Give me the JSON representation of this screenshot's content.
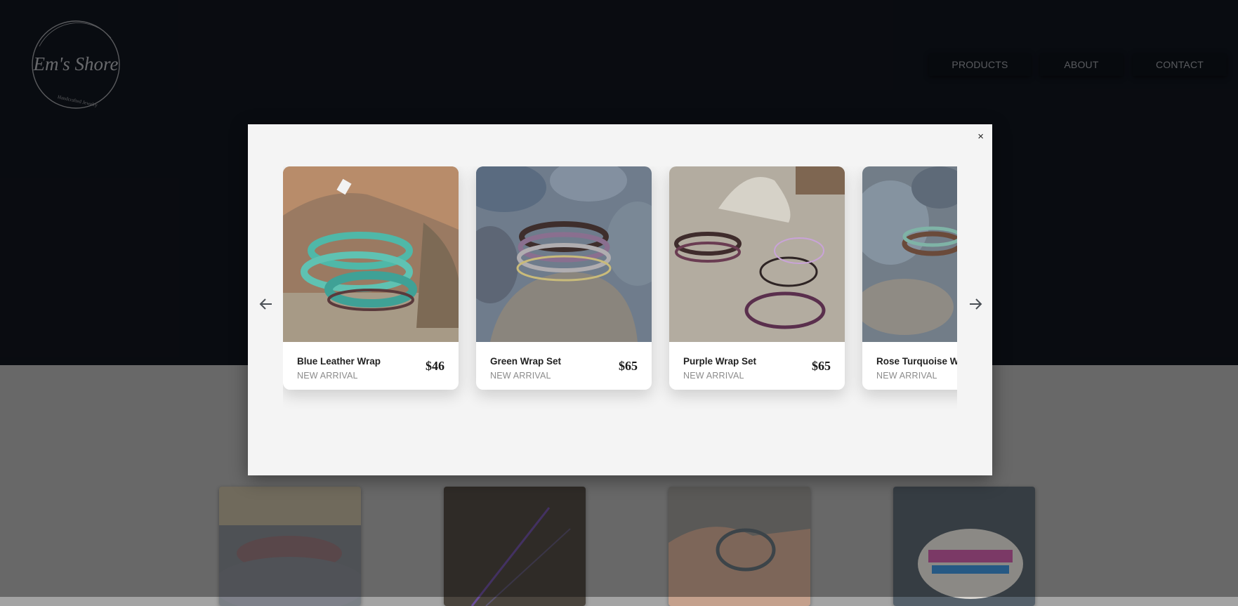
{
  "brand": {
    "name": "Em's Shore",
    "tagline": "Handcrafted Jewelry"
  },
  "nav": {
    "items": [
      "PRODUCTS",
      "ABOUT",
      "CONTACT"
    ]
  },
  "modal": {
    "close_glyph": "×",
    "prev_icon": "arrow-left-icon",
    "next_icon": "arrow-right-icon",
    "products": [
      {
        "name": "Blue Leather Wrap",
        "tag": "NEW ARRIVAL",
        "price": "$46"
      },
      {
        "name": "Green Wrap Set",
        "tag": "NEW ARRIVAL",
        "price": "$65"
      },
      {
        "name": "Purple Wrap Set",
        "tag": "NEW ARRIVAL",
        "price": "$65"
      },
      {
        "name": "Rose Turquoise Wrap",
        "tag": "NEW ARRIVAL",
        "price": ""
      }
    ]
  },
  "colors": {
    "header_bg": "#0f131b",
    "modal_bg": "#f4f4f4",
    "accent_teal": "#3fb5a6"
  }
}
